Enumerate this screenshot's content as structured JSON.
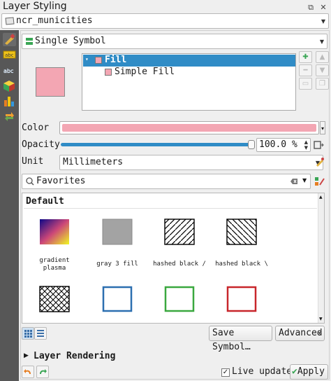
{
  "window": {
    "title": "Layer Styling",
    "title_buttons": [
      "⧉",
      "✕"
    ]
  },
  "layer_combo": {
    "value": "ncr_municities"
  },
  "renderer_combo": {
    "value": "Single Symbol"
  },
  "symbol_tree": {
    "root_label": "Fill",
    "child_label": "Simple Fill"
  },
  "properties": {
    "color_label": "Color",
    "color_value": "#f3a6b3",
    "opacity_label": "Opacity",
    "opacity_value": "100.0 %",
    "opacity_fraction": 1.0,
    "unit_label": "Unit",
    "unit_value": "Millimeters"
  },
  "search": {
    "value": "Favorites"
  },
  "library": {
    "group_title": "Default",
    "symbols": [
      {
        "name": "gradient\nplasma",
        "icon": "gradient-plasma-swatch"
      },
      {
        "name": "gray 3 fill",
        "icon": "gray-fill-swatch"
      },
      {
        "name": "hashed black /",
        "icon": "hatch-forward-swatch"
      },
      {
        "name": "hashed black \\",
        "icon": "hatch-back-swatch"
      },
      {
        "name": "",
        "icon": "crosshatch-swatch"
      },
      {
        "name": "",
        "icon": "blue-outline-swatch"
      },
      {
        "name": "",
        "icon": "green-outline-swatch"
      },
      {
        "name": "",
        "icon": "red-outline-swatch"
      }
    ]
  },
  "buttons": {
    "save_symbol": "Save Symbol…",
    "advanced": "Advanced"
  },
  "layer_rendering": {
    "label": "Layer Rendering"
  },
  "footer": {
    "live_update": "Live update",
    "live_update_checked": true,
    "apply": "Apply"
  },
  "colors": {
    "accent": "#308cc6",
    "fill_pink": "#f3a6b3",
    "sidebar": "#575757"
  }
}
